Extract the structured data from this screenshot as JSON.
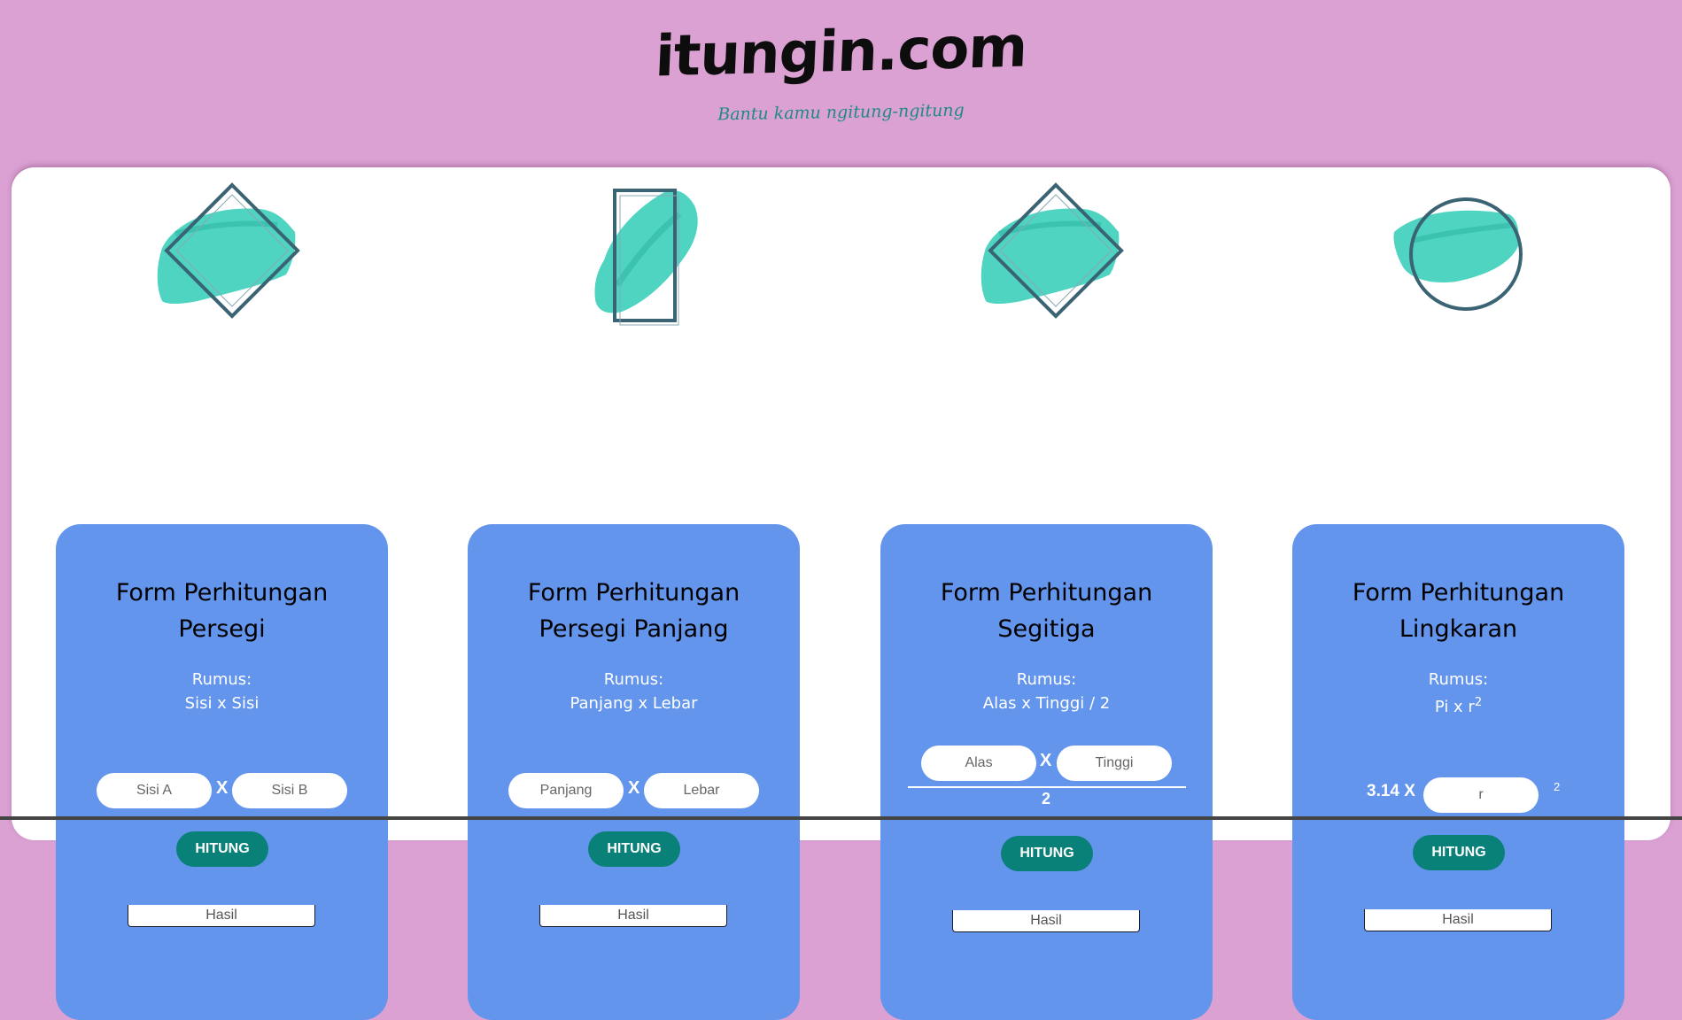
{
  "header": {
    "logo": "itungin.com",
    "tagline": "Bantu kamu ngitung-ngitung"
  },
  "colors": {
    "background": "#dba1d3",
    "card": "#6495ed",
    "button": "#098078",
    "tagline": "#1f8a80",
    "brush": "#3fd0bb",
    "outline": "#3a6374"
  },
  "cards": [
    {
      "icon": "diamond-square-brush-icon",
      "title_line1": "Form Perhitungan",
      "title_line2": "Persegi",
      "formula_label": "Rumus:",
      "formula": "Sisi x Sisi",
      "input1_placeholder": "Sisi A",
      "operator": "X",
      "input2_placeholder": "Sisi B",
      "button": "HITUNG",
      "result_placeholder": "Hasil"
    },
    {
      "icon": "rectangle-brush-icon",
      "title_line1": "Form Perhitungan",
      "title_line2": "Persegi Panjang",
      "formula_label": "Rumus:",
      "formula": "Panjang x Lebar",
      "input1_placeholder": "Panjang",
      "operator": "X",
      "input2_placeholder": "Lebar",
      "button": "HITUNG",
      "result_placeholder": "Hasil"
    },
    {
      "icon": "diamond-triangle-brush-icon",
      "title_line1": "Form Perhitungan",
      "title_line2": "Segitiga",
      "formula_label": "Rumus:",
      "formula": "Alas x Tinggi / 2",
      "input1_placeholder": "Alas",
      "operator": "X",
      "input2_placeholder": "Tinggi",
      "denominator": "2",
      "button": "HITUNG",
      "result_placeholder": "Hasil"
    },
    {
      "icon": "circle-brush-icon",
      "title_line1": "Form Perhitungan",
      "title_line2": "Lingkaran",
      "formula_label": "Rumus:",
      "formula": "Pi x r",
      "formula_sup": "2",
      "constant": "3.14 X",
      "input1_placeholder": "r",
      "exponent": "2",
      "button": "HITUNG",
      "result_placeholder": "Hasil"
    }
  ]
}
